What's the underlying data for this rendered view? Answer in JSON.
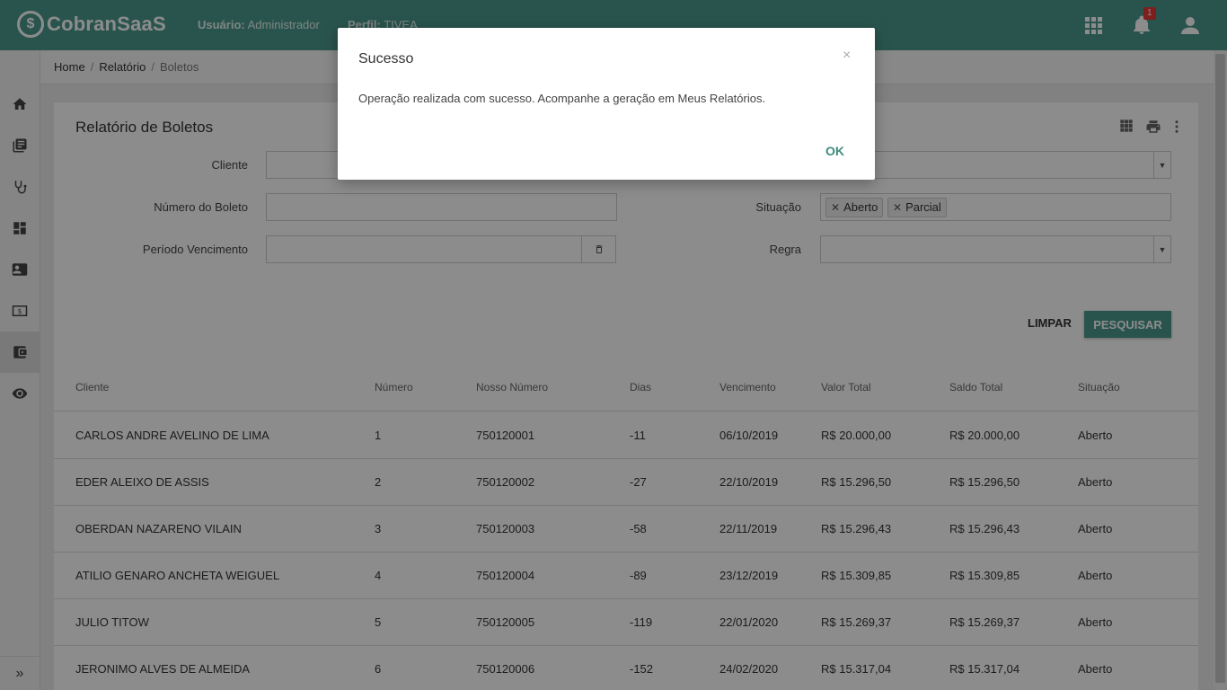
{
  "app": {
    "logo_mark": "$",
    "logo_text": "CobranSaaS",
    "user_label": "Usuário:",
    "user_name": "Administrador",
    "profile_label": "Perfil:",
    "profile_name": "TIVEA",
    "notification_count": "1",
    "accent_color": "#4b9a8c"
  },
  "sidebar": {
    "items": [
      "home-icon",
      "library-books-icon",
      "stethoscope-icon",
      "dashboard-icon",
      "contact-card-icon",
      "money-icon",
      "wallet-icon",
      "eye-icon"
    ],
    "collapse_glyph": "»"
  },
  "breadcrumb": {
    "items": [
      "Home",
      "Relatório",
      "Boletos"
    ]
  },
  "page": {
    "title": "Relatório de Boletos"
  },
  "filters": {
    "cliente_label": "Cliente",
    "numero_boleto_label": "Número do Boleto",
    "periodo_label": "Período Vencimento",
    "situacao_label": "Situação",
    "regra_label": "Regra",
    "situacao_chips": [
      "Aberto",
      "Parcial"
    ],
    "clear_label": "LIMPAR",
    "search_label": "PESQUISAR"
  },
  "table": {
    "columns": [
      "Cliente",
      "Número",
      "Nosso Número",
      "Dias",
      "Vencimento",
      "Valor Total",
      "Saldo Total",
      "Situação"
    ],
    "rows": [
      [
        "CARLOS ANDRE AVELINO DE LIMA",
        "1",
        "750120001",
        "-11",
        "06/10/2019",
        "R$ 20.000,00",
        "R$ 20.000,00",
        "Aberto"
      ],
      [
        "EDER ALEIXO DE ASSIS",
        "2",
        "750120002",
        "-27",
        "22/10/2019",
        "R$ 15.296,50",
        "R$ 15.296,50",
        "Aberto"
      ],
      [
        "OBERDAN NAZARENO VILAIN",
        "3",
        "750120003",
        "-58",
        "22/11/2019",
        "R$ 15.296,43",
        "R$ 15.296,43",
        "Aberto"
      ],
      [
        "ATILIO GENARO ANCHETA WEIGUEL",
        "4",
        "750120004",
        "-89",
        "23/12/2019",
        "R$ 15.309,85",
        "R$ 15.309,85",
        "Aberto"
      ],
      [
        "JULIO TITOW",
        "5",
        "750120005",
        "-119",
        "22/01/2020",
        "R$ 15.269,37",
        "R$ 15.269,37",
        "Aberto"
      ],
      [
        "JERONIMO ALVES DE ALMEIDA",
        "6",
        "750120006",
        "-152",
        "24/02/2020",
        "R$ 15.317,04",
        "R$ 15.317,04",
        "Aberto"
      ]
    ]
  },
  "modal": {
    "title": "Sucesso",
    "close_glyph": "×",
    "message": "Operação realizada com sucesso. Acompanhe a geração em Meus Relatórios.",
    "ok_label": "OK"
  }
}
